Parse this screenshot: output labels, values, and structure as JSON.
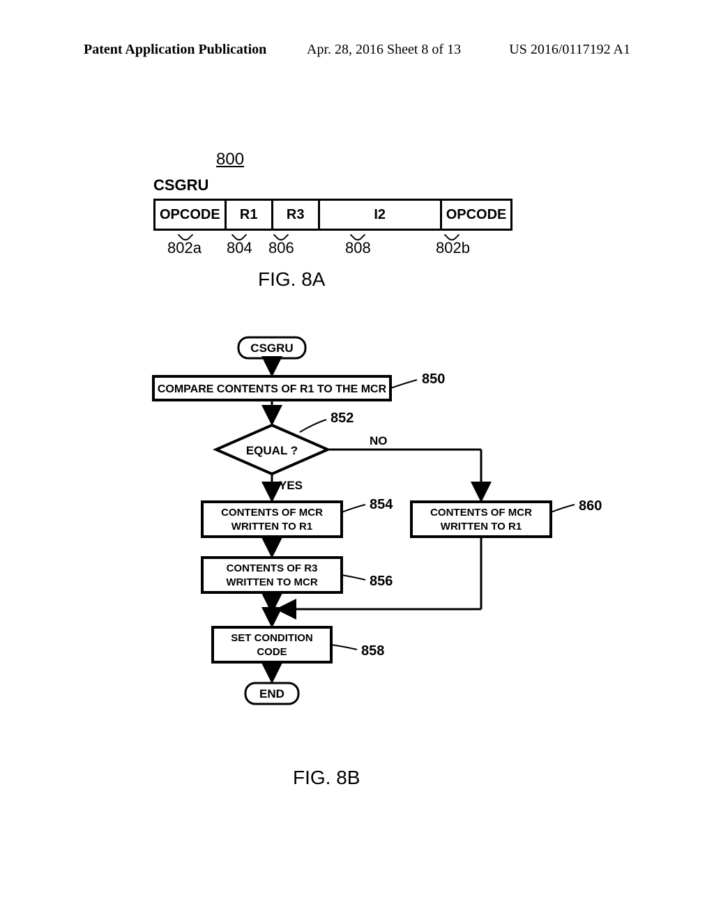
{
  "header": {
    "left": "Patent Application Publication",
    "mid": "Apr. 28, 2016  Sheet 8 of 13",
    "right": "US 2016/0117192 A1"
  },
  "fig8a": {
    "ref800": "800",
    "csgru": "CSGRU",
    "fields": [
      "OPCODE",
      "R1",
      "R3",
      "I2",
      "OPCODE"
    ],
    "refs": [
      "802a",
      "804",
      "806",
      "808",
      "802b"
    ],
    "caption": "FIG. 8A"
  },
  "fig8b": {
    "start": "CSGRU",
    "b850": "COMPARE CONTENTS OF R1 TO THE MCR",
    "r850": "850",
    "decision": "EQUAL ?",
    "r852": "852",
    "yes": "YES",
    "no": "NO",
    "b854_l1": "CONTENTS OF MCR",
    "b854_l2": "WRITTEN TO R1",
    "r854": "854",
    "b856_l1": "CONTENTS OF R3",
    "b856_l2": "WRITTEN TO MCR",
    "r856": "856",
    "b858_l1": "SET CONDITION",
    "b858_l2": "CODE",
    "r858": "858",
    "b860_l1": "CONTENTS OF MCR",
    "b860_l2": "WRITTEN TO R1",
    "r860": "860",
    "end": "END",
    "caption": "FIG. 8B"
  }
}
